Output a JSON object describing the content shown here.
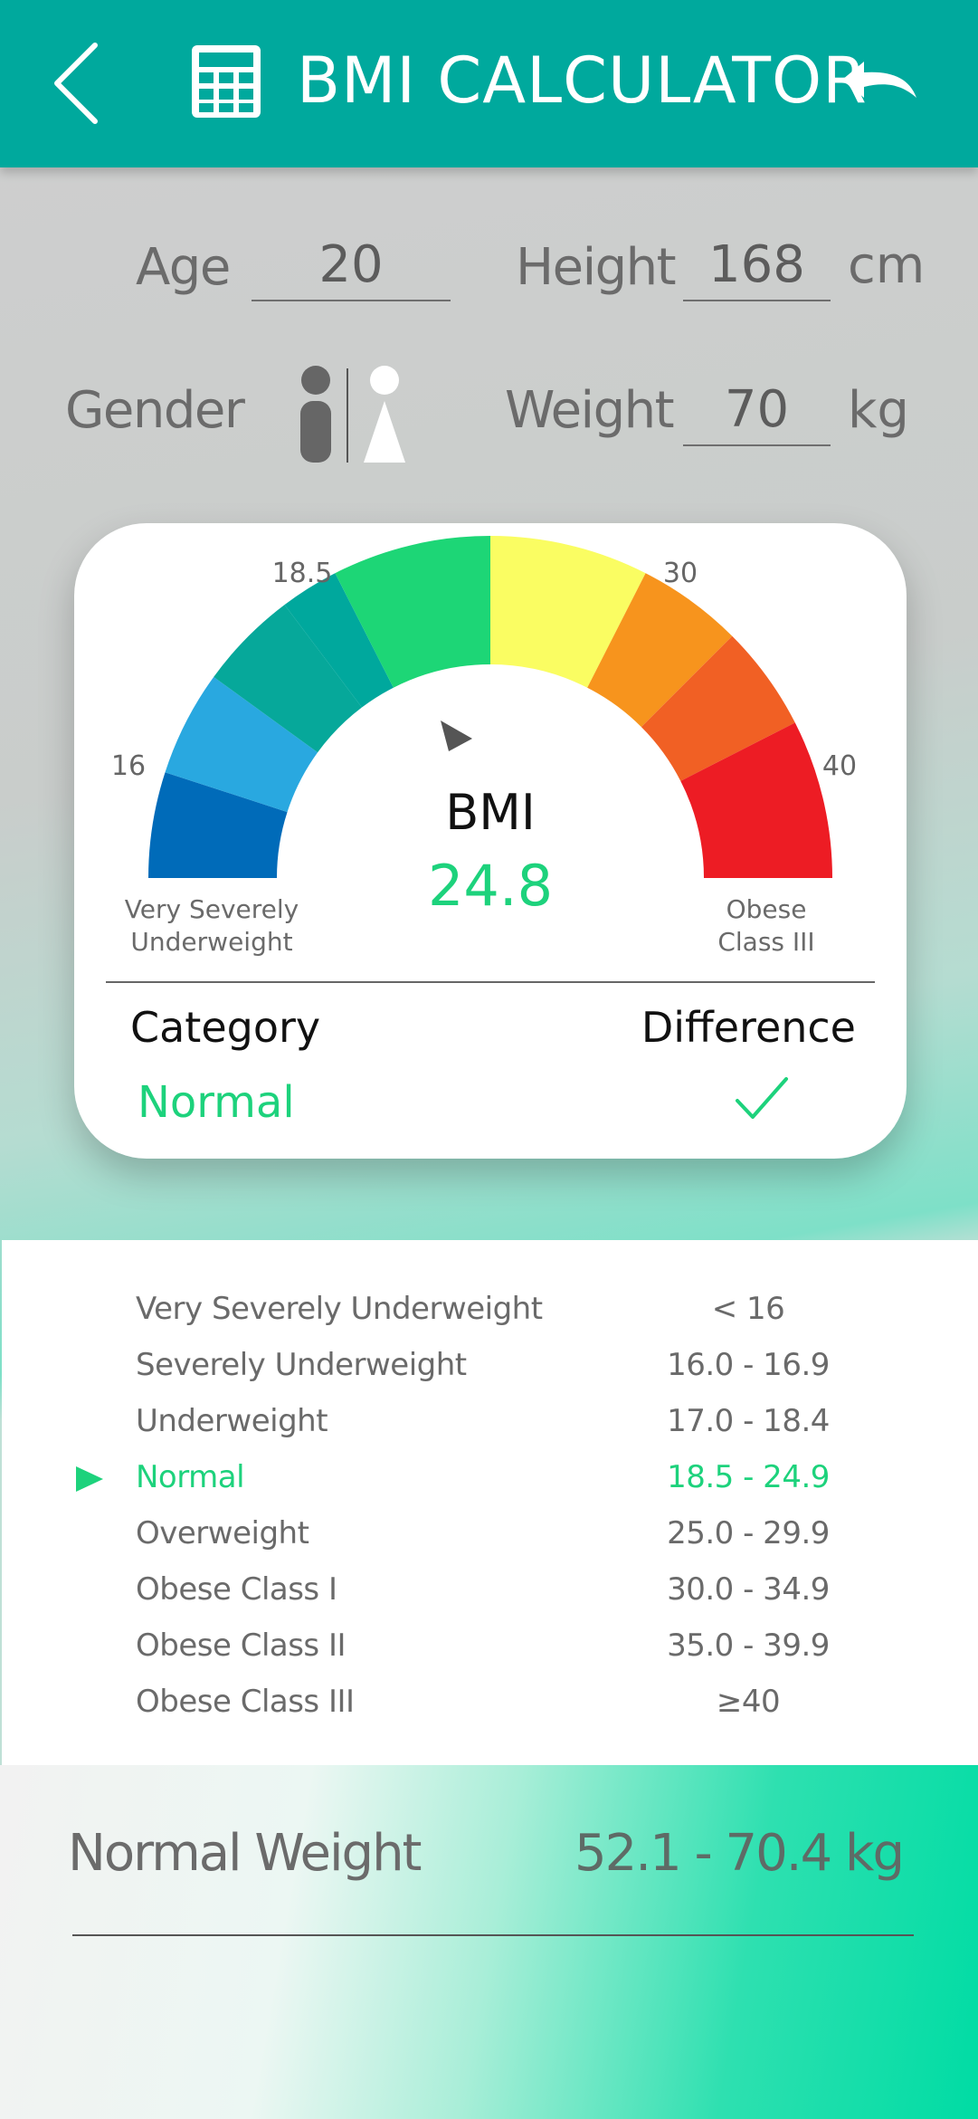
{
  "header": {
    "title": "BMI CALCULATOR",
    "back_icon": "chevron-left-icon",
    "calc_icon": "calculator-icon",
    "undo_icon": "undo-icon",
    "color": "#00a99d"
  },
  "inputs": {
    "age_label": "Age",
    "age_value": "20",
    "height_label": "Height",
    "height_value": "168",
    "height_unit": "cm",
    "gender_label": "Gender",
    "gender_icons": [
      "male-icon",
      "female-icon"
    ],
    "weight_label": "Weight",
    "weight_value": "70",
    "weight_unit": "kg"
  },
  "gauge": {
    "ticks": {
      "t16": "16",
      "t185": "18.5",
      "t30": "30",
      "t40": "40"
    },
    "left_caption": [
      "Very Severely",
      "Underweight"
    ],
    "right_caption": [
      "Obese",
      "Class III"
    ],
    "bmi_label": "BMI",
    "bmi_value": "24.8",
    "bmi_value_color": "#1dd27c",
    "segment_colors": [
      "#006bb9",
      "#29a8e0",
      "#06a89a",
      "#00a89d",
      "#1dd676",
      "#fafd62",
      "#f7941d",
      "#f16024",
      "#ed1c24"
    ]
  },
  "result": {
    "category_label": "Category",
    "category_value": "Normal",
    "difference_label": "Difference",
    "difference_icon": "checkmark-icon"
  },
  "table": [
    {
      "name": "Very Severely Underweight",
      "range": "< 16",
      "active": false
    },
    {
      "name": "Severely Underweight",
      "range": "16.0 - 16.9",
      "active": false
    },
    {
      "name": "Underweight",
      "range": "17.0 - 18.4",
      "active": false
    },
    {
      "name": "Normal",
      "range": "18.5 - 24.9",
      "active": true
    },
    {
      "name": "Overweight",
      "range": "25.0 - 29.9",
      "active": false
    },
    {
      "name": "Obese Class I",
      "range": "30.0 - 34.9",
      "active": false
    },
    {
      "name": "Obese Class II",
      "range": "35.0 - 39.9",
      "active": false
    },
    {
      "name": "Obese Class III",
      "range": "≥40",
      "active": false
    }
  ],
  "normal_weight": {
    "label": "Normal Weight",
    "value": "52.1 - 70.4 kg"
  }
}
